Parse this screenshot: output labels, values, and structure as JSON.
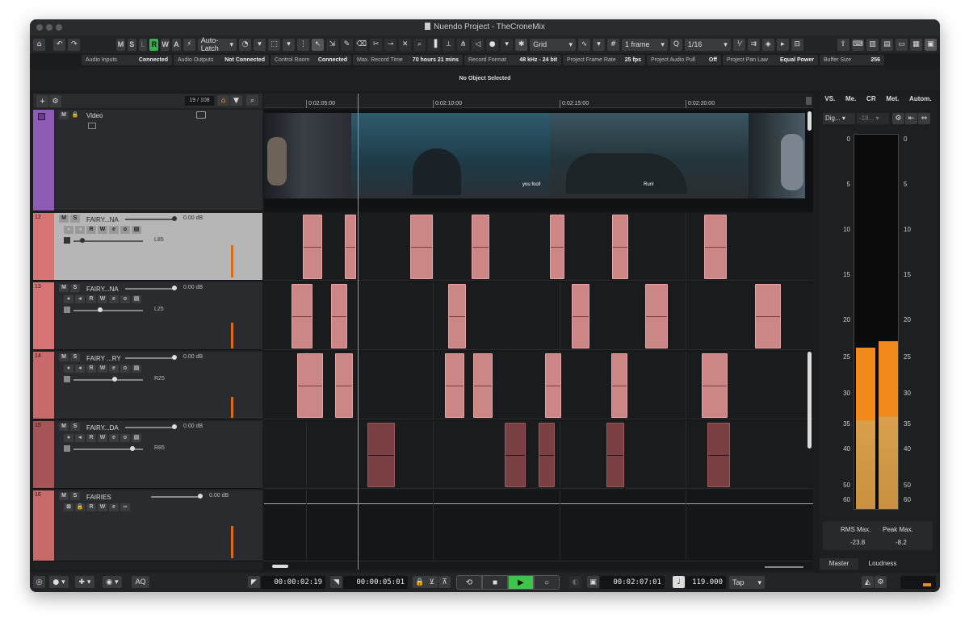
{
  "window": {
    "title": "Nuendo Project - TheCroneMix"
  },
  "toolbar": {
    "ms_buttons": [
      "M",
      "S",
      "L",
      "R",
      "W",
      "A"
    ],
    "automation_mode": "Auto-Latch",
    "snap_type": "Grid",
    "grid_value": "1 frame",
    "quantize_value": "1/16"
  },
  "infobar": [
    {
      "label": "Audio Inputs",
      "value": "Connected"
    },
    {
      "label": "Audio Outputs",
      "value": "Not Connected"
    },
    {
      "label": "Control Room",
      "value": "Connected"
    },
    {
      "label": "Max. Record Time",
      "value": "70 hours 21 mins"
    },
    {
      "label": "Record Format",
      "value": "48 kHz - 24 bit"
    },
    {
      "label": "Project Frame Rate",
      "value": "25 fps"
    },
    {
      "label": "Project Audio Pull",
      "value": "Off"
    },
    {
      "label": "Project Pan Law",
      "value": "Equal Power"
    },
    {
      "label": "Buffer Size",
      "value": "256"
    }
  ],
  "status": "No Object Selected",
  "trackpanel": {
    "counter": "19 / 108"
  },
  "tracks": [
    {
      "num": "",
      "name": "Video",
      "kind": "video"
    },
    {
      "num": "12",
      "name": "FAIRY...NA",
      "volume": "0.00 dB",
      "pan": "L85"
    },
    {
      "num": "13",
      "name": "FAIRY...NA",
      "volume": "0.00 dB",
      "pan": "L25"
    },
    {
      "num": "14",
      "name": "FAIRY ...RY",
      "volume": "0.00 dB",
      "pan": "R25"
    },
    {
      "num": "15",
      "name": "FAIRY...DA",
      "volume": "0.00 dB",
      "pan": "R85"
    },
    {
      "num": "16",
      "name": "FAIRIES",
      "volume": "0.00 dB",
      "pan": ""
    }
  ],
  "ruler": {
    "labels": [
      "0:02:05:00",
      "0:02:10:00",
      "0:02:15:00",
      "0:02:20:00"
    ]
  },
  "video": {
    "subtitles": [
      "you fool!",
      "Run!"
    ]
  },
  "meter": {
    "tabs": [
      "VS.",
      "Me.",
      "CR",
      "Met.",
      "Autom."
    ],
    "source": "Dig...",
    "reference": "-18...",
    "scale": [
      "0",
      "5",
      "10",
      "15",
      "20",
      "25",
      "30",
      "35",
      "40",
      "50",
      "60"
    ],
    "rms_label": "RMS Max.",
    "rms_value": "-23.8",
    "peak_label": "Peak Max.",
    "peak_value": "-8.2",
    "bottom_tabs": [
      "Master",
      "Loudness"
    ]
  },
  "transport": {
    "left_locator": "00:00:02:19",
    "right_locator": "00:00:05:01",
    "position": "00:02:07:01",
    "tempo": "119.000",
    "tap": "Tap",
    "aq": "AQ"
  }
}
